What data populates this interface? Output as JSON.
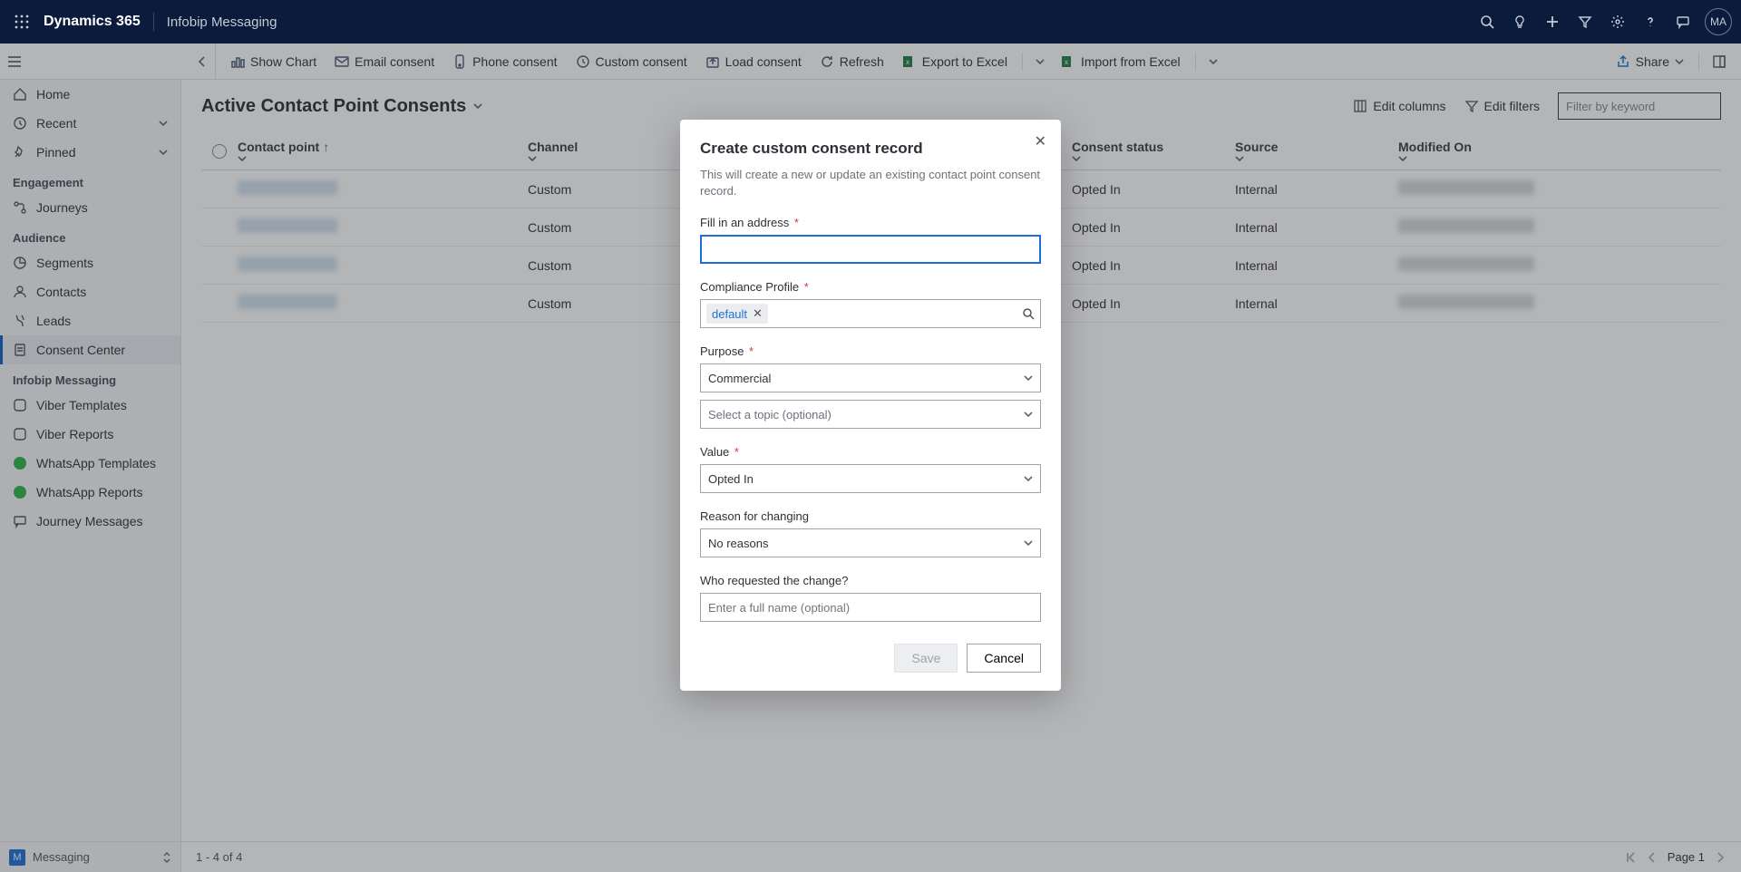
{
  "topbar": {
    "brand": "Dynamics 365",
    "app": "Infobip Messaging",
    "avatar": "MA"
  },
  "cmdbar": {
    "show_chart": "Show Chart",
    "email_consent": "Email consent",
    "phone_consent": "Phone consent",
    "custom_consent": "Custom consent",
    "load_consent": "Load consent",
    "refresh": "Refresh",
    "export_excel": "Export to Excel",
    "import_excel": "Import from Excel",
    "share": "Share"
  },
  "sidebar": {
    "home": "Home",
    "recent": "Recent",
    "pinned": "Pinned",
    "g_engagement": "Engagement",
    "journeys": "Journeys",
    "g_audience": "Audience",
    "segments": "Segments",
    "contacts": "Contacts",
    "leads": "Leads",
    "consent_center": "Consent Center",
    "g_infobip": "Infobip Messaging",
    "viber_templates": "Viber Templates",
    "viber_reports": "Viber Reports",
    "whatsapp_templates": "WhatsApp Templates",
    "whatsapp_reports": "WhatsApp Reports",
    "journey_messages": "Journey Messages"
  },
  "view": {
    "title": "Active Contact Point Consents",
    "edit_columns": "Edit columns",
    "edit_filters": "Edit filters",
    "filter_placeholder": "Filter by keyword"
  },
  "columns": {
    "contact_point": "Contact point",
    "channel": "Channel",
    "topic": "",
    "consent_status": "Consent status",
    "source": "Source",
    "modified_on": "Modified On"
  },
  "rows": [
    {
      "channel": "Custom",
      "status": "Opted In",
      "source": "Internal"
    },
    {
      "channel": "Custom",
      "status": "Opted In",
      "source": "Internal"
    },
    {
      "channel": "Custom",
      "status": "Opted In",
      "source": "Internal"
    },
    {
      "channel": "Custom",
      "status": "Opted In",
      "source": "Internal"
    }
  ],
  "bottom": {
    "area_letter": "M",
    "area": "Messaging",
    "status": "1 - 4 of 4",
    "page": "Page 1"
  },
  "dialog": {
    "title": "Create custom consent record",
    "desc": "This will create a new or update an existing contact point consent record.",
    "address_label": "Fill in an address",
    "compliance_label": "Compliance Profile",
    "compliance_chip": "default",
    "purpose_label": "Purpose",
    "purpose_value": "Commercial",
    "topic_placeholder": "Select a topic (optional)",
    "value_label": "Value",
    "value_value": "Opted In",
    "reason_label": "Reason for changing",
    "reason_value": "No reasons",
    "who_label": "Who requested the change?",
    "who_placeholder": "Enter a full name (optional)",
    "save": "Save",
    "cancel": "Cancel",
    "required": "*"
  }
}
